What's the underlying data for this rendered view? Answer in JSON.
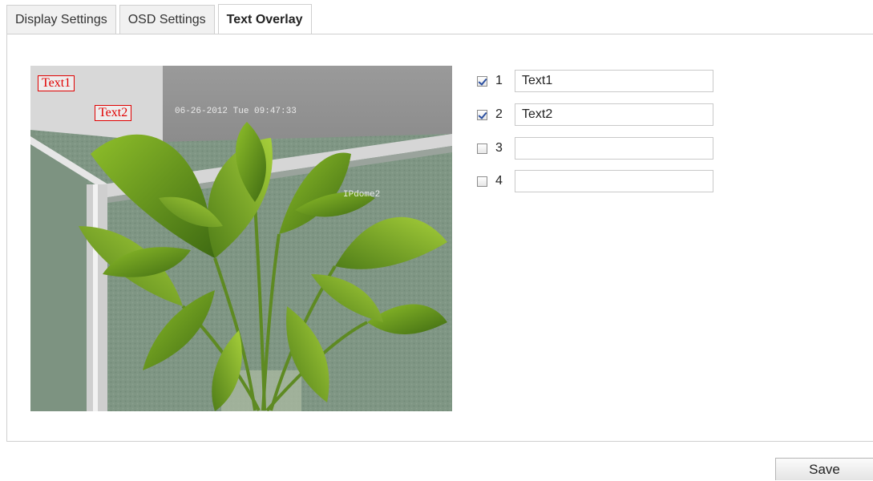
{
  "tabs": [
    {
      "label": "Display Settings",
      "active": false
    },
    {
      "label": "OSD Settings",
      "active": false
    },
    {
      "label": "Text Overlay",
      "active": true
    }
  ],
  "preview": {
    "overlays": [
      "Text1",
      "Text2"
    ],
    "osd_datetime": "06-26-2012 Tue 09:47:33",
    "osd_camera_name": "IPdome2"
  },
  "text_rows": [
    {
      "index": "1",
      "checked": true,
      "value": "Text1"
    },
    {
      "index": "2",
      "checked": true,
      "value": "Text2"
    },
    {
      "index": "3",
      "checked": false,
      "value": ""
    },
    {
      "index": "4",
      "checked": false,
      "value": ""
    }
  ],
  "save_label": "Save",
  "colors": {
    "overlay_border": "#e00000",
    "panel_border": "#cfcfcf",
    "checkbox_check": "#2a4fa0"
  }
}
